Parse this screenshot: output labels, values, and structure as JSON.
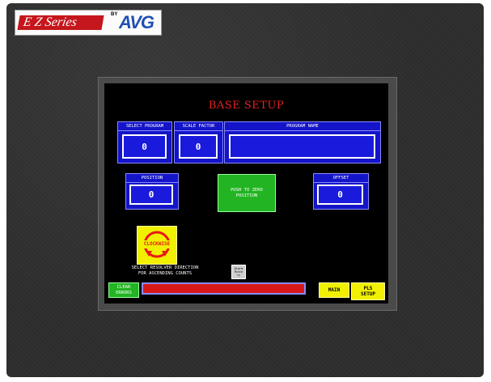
{
  "branding": {
    "series_logo": "E Z Series",
    "by_label": "BY",
    "maker_logo": "AVG"
  },
  "screen": {
    "title": "BASE SETUP",
    "select_program": {
      "label": "SELECT PROGRAM",
      "value": "0"
    },
    "scale_factor": {
      "label": "SCALE FACTOR",
      "value": "0"
    },
    "program_name": {
      "label": "PROGRAM NAME",
      "value": ""
    },
    "position": {
      "label": "POSITION",
      "value": "0"
    },
    "push_to_zero": {
      "line1": "PUSH TO ZERO",
      "line2": "POSITION"
    },
    "offset": {
      "label": "OFFSET",
      "value": "0"
    },
    "direction": {
      "label": "CLOCKWISE"
    },
    "instructions": {
      "line1": "SELECT RESOLVER DIRECTION",
      "line2": "FOR ASCENDING COUNTS"
    },
    "alarm_history": {
      "line1": "Alarm",
      "line2": "Histo",
      "line3": "ry"
    },
    "clear_errors": {
      "line1": "CLEAR",
      "line2": "ERRORS"
    },
    "main_button": "MAIN",
    "pls_setup": {
      "line1": "PLS",
      "line2": "SETUP"
    }
  },
  "colors": {
    "screen_bg": "#000000",
    "title": "#e52020",
    "panel_blue": "#1414c8",
    "button_green": "#22b422",
    "button_yellow": "#f0f000",
    "error_bar": "#d81818"
  }
}
